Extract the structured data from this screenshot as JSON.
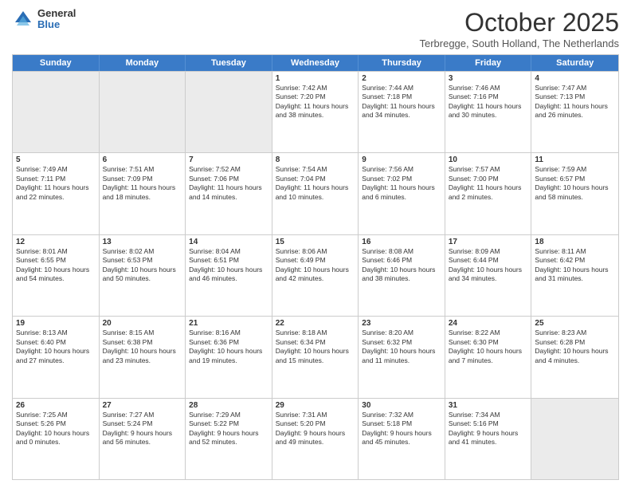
{
  "logo": {
    "general": "General",
    "blue": "Blue"
  },
  "header": {
    "month": "October 2025",
    "location": "Terbregge, South Holland, The Netherlands"
  },
  "days": [
    "Sunday",
    "Monday",
    "Tuesday",
    "Wednesday",
    "Thursday",
    "Friday",
    "Saturday"
  ],
  "weeks": [
    [
      {
        "day": "",
        "sunrise": "",
        "sunset": "",
        "daylight": "",
        "empty": true
      },
      {
        "day": "",
        "sunrise": "",
        "sunset": "",
        "daylight": "",
        "empty": true
      },
      {
        "day": "",
        "sunrise": "",
        "sunset": "",
        "daylight": "",
        "empty": true
      },
      {
        "day": "1",
        "sunrise": "Sunrise: 7:42 AM",
        "sunset": "Sunset: 7:20 PM",
        "daylight": "Daylight: 11 hours and 38 minutes."
      },
      {
        "day": "2",
        "sunrise": "Sunrise: 7:44 AM",
        "sunset": "Sunset: 7:18 PM",
        "daylight": "Daylight: 11 hours and 34 minutes."
      },
      {
        "day": "3",
        "sunrise": "Sunrise: 7:46 AM",
        "sunset": "Sunset: 7:16 PM",
        "daylight": "Daylight: 11 hours and 30 minutes."
      },
      {
        "day": "4",
        "sunrise": "Sunrise: 7:47 AM",
        "sunset": "Sunset: 7:13 PM",
        "daylight": "Daylight: 11 hours and 26 minutes."
      }
    ],
    [
      {
        "day": "5",
        "sunrise": "Sunrise: 7:49 AM",
        "sunset": "Sunset: 7:11 PM",
        "daylight": "Daylight: 11 hours and 22 minutes."
      },
      {
        "day": "6",
        "sunrise": "Sunrise: 7:51 AM",
        "sunset": "Sunset: 7:09 PM",
        "daylight": "Daylight: 11 hours and 18 minutes."
      },
      {
        "day": "7",
        "sunrise": "Sunrise: 7:52 AM",
        "sunset": "Sunset: 7:06 PM",
        "daylight": "Daylight: 11 hours and 14 minutes."
      },
      {
        "day": "8",
        "sunrise": "Sunrise: 7:54 AM",
        "sunset": "Sunset: 7:04 PM",
        "daylight": "Daylight: 11 hours and 10 minutes."
      },
      {
        "day": "9",
        "sunrise": "Sunrise: 7:56 AM",
        "sunset": "Sunset: 7:02 PM",
        "daylight": "Daylight: 11 hours and 6 minutes."
      },
      {
        "day": "10",
        "sunrise": "Sunrise: 7:57 AM",
        "sunset": "Sunset: 7:00 PM",
        "daylight": "Daylight: 11 hours and 2 minutes."
      },
      {
        "day": "11",
        "sunrise": "Sunrise: 7:59 AM",
        "sunset": "Sunset: 6:57 PM",
        "daylight": "Daylight: 10 hours and 58 minutes."
      }
    ],
    [
      {
        "day": "12",
        "sunrise": "Sunrise: 8:01 AM",
        "sunset": "Sunset: 6:55 PM",
        "daylight": "Daylight: 10 hours and 54 minutes."
      },
      {
        "day": "13",
        "sunrise": "Sunrise: 8:02 AM",
        "sunset": "Sunset: 6:53 PM",
        "daylight": "Daylight: 10 hours and 50 minutes."
      },
      {
        "day": "14",
        "sunrise": "Sunrise: 8:04 AM",
        "sunset": "Sunset: 6:51 PM",
        "daylight": "Daylight: 10 hours and 46 minutes."
      },
      {
        "day": "15",
        "sunrise": "Sunrise: 8:06 AM",
        "sunset": "Sunset: 6:49 PM",
        "daylight": "Daylight: 10 hours and 42 minutes."
      },
      {
        "day": "16",
        "sunrise": "Sunrise: 8:08 AM",
        "sunset": "Sunset: 6:46 PM",
        "daylight": "Daylight: 10 hours and 38 minutes."
      },
      {
        "day": "17",
        "sunrise": "Sunrise: 8:09 AM",
        "sunset": "Sunset: 6:44 PM",
        "daylight": "Daylight: 10 hours and 34 minutes."
      },
      {
        "day": "18",
        "sunrise": "Sunrise: 8:11 AM",
        "sunset": "Sunset: 6:42 PM",
        "daylight": "Daylight: 10 hours and 31 minutes."
      }
    ],
    [
      {
        "day": "19",
        "sunrise": "Sunrise: 8:13 AM",
        "sunset": "Sunset: 6:40 PM",
        "daylight": "Daylight: 10 hours and 27 minutes."
      },
      {
        "day": "20",
        "sunrise": "Sunrise: 8:15 AM",
        "sunset": "Sunset: 6:38 PM",
        "daylight": "Daylight: 10 hours and 23 minutes."
      },
      {
        "day": "21",
        "sunrise": "Sunrise: 8:16 AM",
        "sunset": "Sunset: 6:36 PM",
        "daylight": "Daylight: 10 hours and 19 minutes."
      },
      {
        "day": "22",
        "sunrise": "Sunrise: 8:18 AM",
        "sunset": "Sunset: 6:34 PM",
        "daylight": "Daylight: 10 hours and 15 minutes."
      },
      {
        "day": "23",
        "sunrise": "Sunrise: 8:20 AM",
        "sunset": "Sunset: 6:32 PM",
        "daylight": "Daylight: 10 hours and 11 minutes."
      },
      {
        "day": "24",
        "sunrise": "Sunrise: 8:22 AM",
        "sunset": "Sunset: 6:30 PM",
        "daylight": "Daylight: 10 hours and 7 minutes."
      },
      {
        "day": "25",
        "sunrise": "Sunrise: 8:23 AM",
        "sunset": "Sunset: 6:28 PM",
        "daylight": "Daylight: 10 hours and 4 minutes."
      }
    ],
    [
      {
        "day": "26",
        "sunrise": "Sunrise: 7:25 AM",
        "sunset": "Sunset: 5:26 PM",
        "daylight": "Daylight: 10 hours and 0 minutes."
      },
      {
        "day": "27",
        "sunrise": "Sunrise: 7:27 AM",
        "sunset": "Sunset: 5:24 PM",
        "daylight": "Daylight: 9 hours and 56 minutes."
      },
      {
        "day": "28",
        "sunrise": "Sunrise: 7:29 AM",
        "sunset": "Sunset: 5:22 PM",
        "daylight": "Daylight: 9 hours and 52 minutes."
      },
      {
        "day": "29",
        "sunrise": "Sunrise: 7:31 AM",
        "sunset": "Sunset: 5:20 PM",
        "daylight": "Daylight: 9 hours and 49 minutes."
      },
      {
        "day": "30",
        "sunrise": "Sunrise: 7:32 AM",
        "sunset": "Sunset: 5:18 PM",
        "daylight": "Daylight: 9 hours and 45 minutes."
      },
      {
        "day": "31",
        "sunrise": "Sunrise: 7:34 AM",
        "sunset": "Sunset: 5:16 PM",
        "daylight": "Daylight: 9 hours and 41 minutes."
      },
      {
        "day": "",
        "sunrise": "",
        "sunset": "",
        "daylight": "",
        "empty": true
      }
    ]
  ]
}
